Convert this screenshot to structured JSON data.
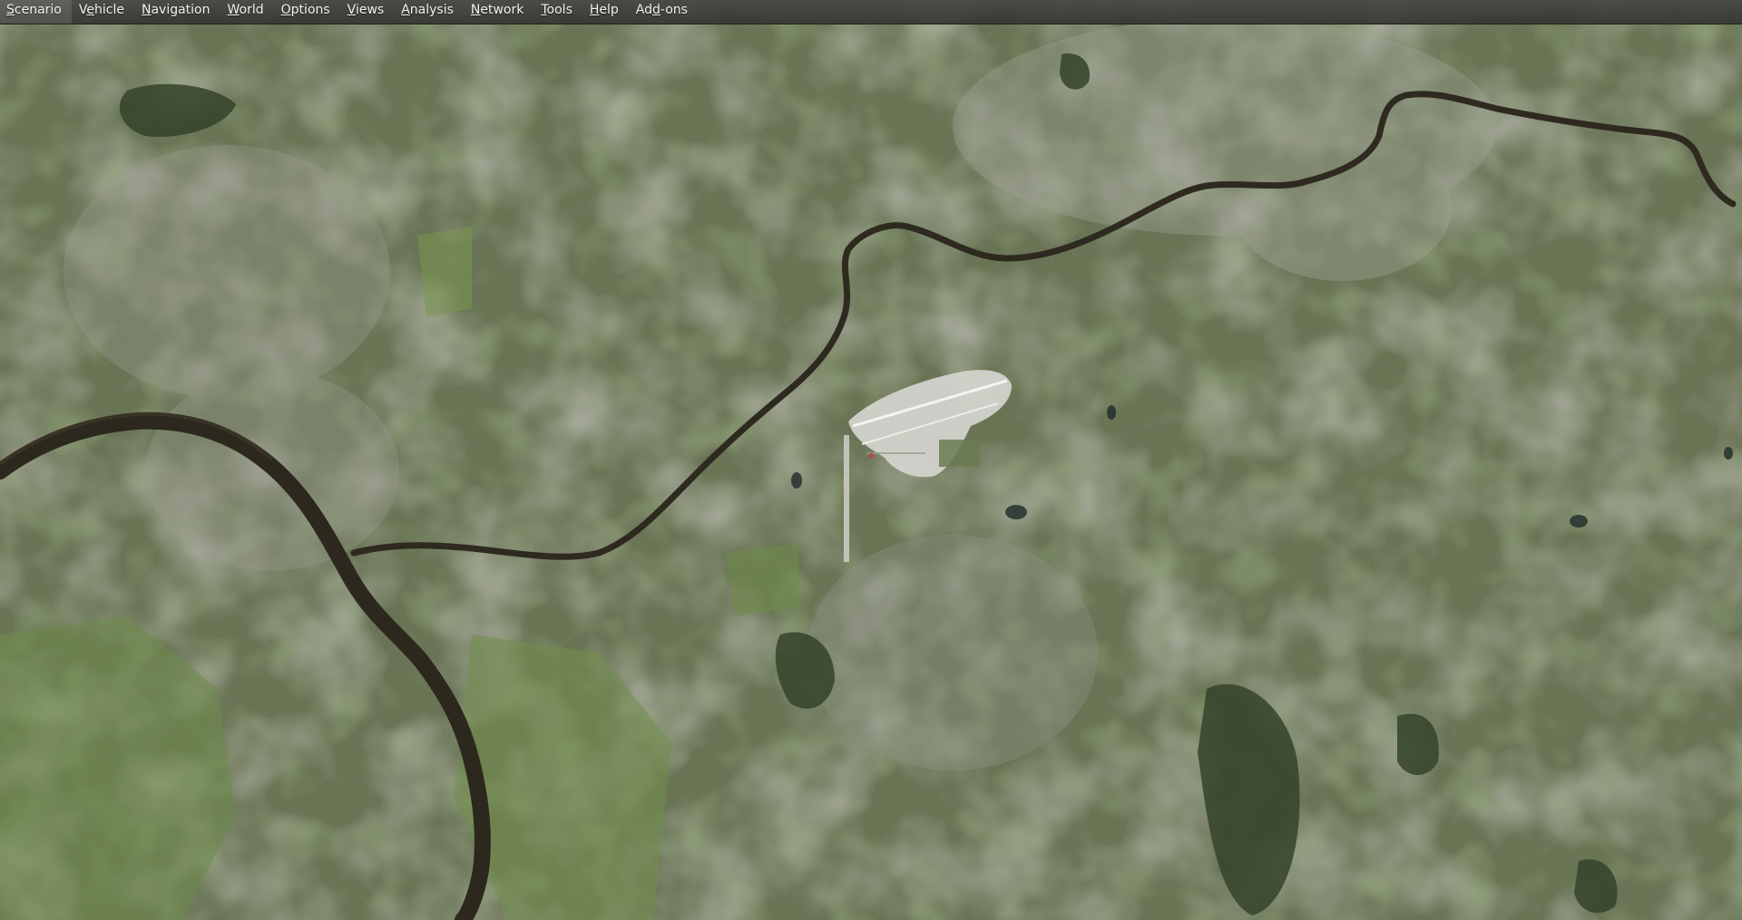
{
  "window": {
    "type": "flight simulator satellite map view"
  },
  "menubar": {
    "items": [
      {
        "label": "Scenario",
        "mnemonic_index": 0
      },
      {
        "label": "Vehicle",
        "mnemonic_index": 1
      },
      {
        "label": "Navigation",
        "mnemonic_index": 0
      },
      {
        "label": "World",
        "mnemonic_index": 0
      },
      {
        "label": "Options",
        "mnemonic_index": 0
      },
      {
        "label": "Views",
        "mnemonic_index": 0
      },
      {
        "label": "Analysis",
        "mnemonic_index": 0
      },
      {
        "label": "Network",
        "mnemonic_index": 0
      },
      {
        "label": "Tools",
        "mnemonic_index": 0
      },
      {
        "label": "Help",
        "mnemonic_index": 0
      },
      {
        "label": "Add-ons",
        "mnemonic_index": 2
      }
    ]
  },
  "map": {
    "terrain_color": "#5e6a48",
    "urban_color": "#8b8d80",
    "river_color": "#2e2a1f",
    "forest_color": "#3a4a2a",
    "field_color": "#6f8a4a",
    "airport_color": "#d8d8d2"
  }
}
